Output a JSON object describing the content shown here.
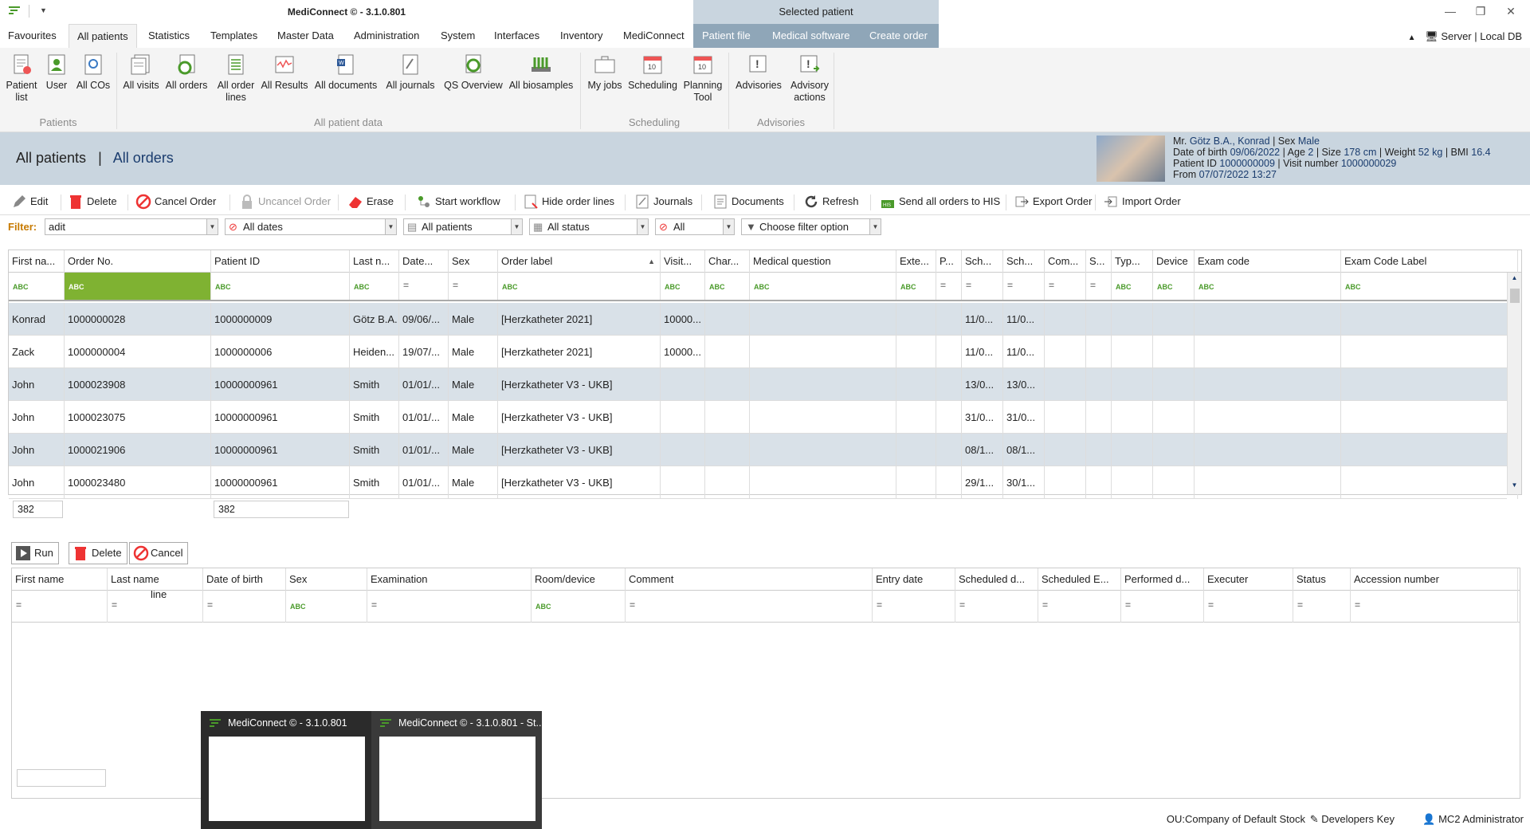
{
  "app": {
    "title": "MediConnect © - 3.1.0.801",
    "context_title": "Selected patient",
    "server_label": "Server",
    "db_label": "Local DB"
  },
  "tabs": [
    "Favourites",
    "All patients",
    "Statistics",
    "Templates",
    "Master Data",
    "Administration",
    "System",
    "Interfaces",
    "Inventory",
    "MediConnect"
  ],
  "context_tabs": [
    "Patient file",
    "Medical software",
    "Create order"
  ],
  "ribbon": {
    "patients": {
      "label": "Patients",
      "buttons": [
        [
          "Patient",
          "list"
        ],
        [
          "User",
          ""
        ],
        [
          "All COs",
          ""
        ]
      ]
    },
    "all_patient_data": {
      "label": "All patient data",
      "buttons": [
        [
          "All visits",
          ""
        ],
        [
          "All orders",
          ""
        ],
        [
          "All order",
          "lines"
        ],
        [
          "All Results",
          ""
        ],
        [
          "All documents",
          ""
        ],
        [
          "All journals",
          ""
        ],
        [
          "QS Overview",
          ""
        ],
        [
          "All biosamples",
          ""
        ]
      ]
    },
    "scheduling": {
      "label": "Scheduling",
      "buttons": [
        [
          "My jobs",
          ""
        ],
        [
          "Scheduling",
          ""
        ],
        [
          "Planning",
          "Tool"
        ]
      ]
    },
    "advisories": {
      "label": "Advisories",
      "buttons": [
        [
          "Advisories",
          ""
        ],
        [
          "Advisory",
          "actions"
        ]
      ]
    }
  },
  "breadcrumb": {
    "root": "All patients",
    "sep": "|",
    "current": "All orders"
  },
  "patient": {
    "salutation": "Mr.",
    "name": "Götz B.A., Konrad",
    "sex_label": "| Sex",
    "sex": "Male",
    "dob_label": "Date of birth",
    "dob": "09/06/2022",
    "age_label": "| Age",
    "age": "2",
    "size_label": "| Size",
    "size": "178 cm",
    "weight_label": "| Weight",
    "weight": "52 kg",
    "bmi_label": "| BMI",
    "bmi": "16.4",
    "pid_label": "Patient ID",
    "pid": "1000000009",
    "visit_label": "| Visit number",
    "visit": "1000000029",
    "from_label": "From",
    "from": "07/07/2022 13:27"
  },
  "toolbar": {
    "edit": "Edit",
    "delete": "Delete",
    "cancel_order": "Cancel Order",
    "uncancel_order": "Uncancel Order",
    "erase": "Erase",
    "start_workflow": "Start workflow",
    "hide_order_lines": "Hide order lines",
    "journals": "Journals",
    "documents": "Documents",
    "refresh": "Refresh",
    "send_all": "Send all orders to HIS",
    "export": "Export Order",
    "import": "Import Order"
  },
  "filter": {
    "label": "Filter:",
    "text": "adit",
    "dates": "All dates",
    "patients": "All patients",
    "status": "All status",
    "all": "All",
    "choose": "Choose filter option"
  },
  "orders": {
    "columns": [
      "First na...",
      "Order No.",
      "Patient ID",
      "Last n...",
      "Date...",
      "Sex",
      "Order label",
      "Visit...",
      "Char...",
      "Medical question",
      "Exte...",
      "P...",
      "Sch...",
      "Sch...",
      "Com...",
      "S...",
      "Typ...",
      "Device",
      "Exam code",
      "Exam Code Label"
    ],
    "rows": [
      [
        "Konrad",
        "1000000028",
        "1000000009",
        "Götz B.A.",
        "09/06/...",
        "Male",
        "[Herzkatheter 2021]",
        "10000...",
        "",
        "",
        "",
        "",
        "11/0...",
        "11/0...",
        "",
        "",
        "",
        "",
        "",
        ""
      ],
      [
        "Zack",
        "1000000004",
        "1000000006",
        "Heiden...",
        "19/07/...",
        "Male",
        "[Herzkatheter 2021]",
        "10000...",
        "",
        "",
        "",
        "",
        "11/0...",
        "11/0...",
        "",
        "",
        "",
        "",
        "",
        ""
      ],
      [
        "John",
        "1000023908",
        "10000000961",
        "Smith",
        "01/01/...",
        "Male",
        "[Herzkatheter V3 - UKB]",
        "",
        "",
        "",
        "",
        "",
        "13/0...",
        "13/0...",
        "",
        "",
        "",
        "",
        "",
        ""
      ],
      [
        "John",
        "1000023075",
        "10000000961",
        "Smith",
        "01/01/...",
        "Male",
        "[Herzkatheter V3 - UKB]",
        "",
        "",
        "",
        "",
        "",
        "31/0...",
        "31/0...",
        "",
        "",
        "",
        "",
        "",
        ""
      ],
      [
        "John",
        "1000021906",
        "10000000961",
        "Smith",
        "01/01/...",
        "Male",
        "[Herzkatheter V3 - UKB]",
        "",
        "",
        "",
        "",
        "",
        "08/1...",
        "08/1...",
        "",
        "",
        "",
        "",
        "",
        ""
      ],
      [
        "John",
        "1000023480",
        "10000000961",
        "Smith",
        "01/01/...",
        "Male",
        "[Herzkatheter V3 - UKB]",
        "",
        "",
        "",
        "",
        "",
        "29/1...",
        "30/1...",
        "",
        "",
        "",
        "",
        "",
        ""
      ]
    ],
    "count1": "382",
    "count2": "382"
  },
  "lines_toolbar": {
    "run": "Run",
    "delete": "Delete",
    "cancel_line": "Cancel order line"
  },
  "lines": {
    "columns": [
      "First name",
      "Last name",
      "Date of birth",
      "Sex",
      "Examination",
      "Room/device",
      "Comment",
      "Entry date",
      "Scheduled d...",
      "Scheduled E...",
      "Performed d...",
      "Executer",
      "Status",
      "Accession number"
    ]
  },
  "taskbar": {
    "win1": "MediConnect © - 3.1.0.801",
    "win2": "MediConnect © - 3.1.0.801 - St..."
  },
  "status": {
    "ou": "OU:Company of Default Stock",
    "key": "Developers Key",
    "user": "MC2 Administrator"
  },
  "colors": {
    "accent": "#1a3c6e",
    "header_bg": "#c9d5df",
    "context_tab_bg": "#8fa6b8",
    "alt_row": "#d9e1e8",
    "filter_green": "#7fb232"
  }
}
